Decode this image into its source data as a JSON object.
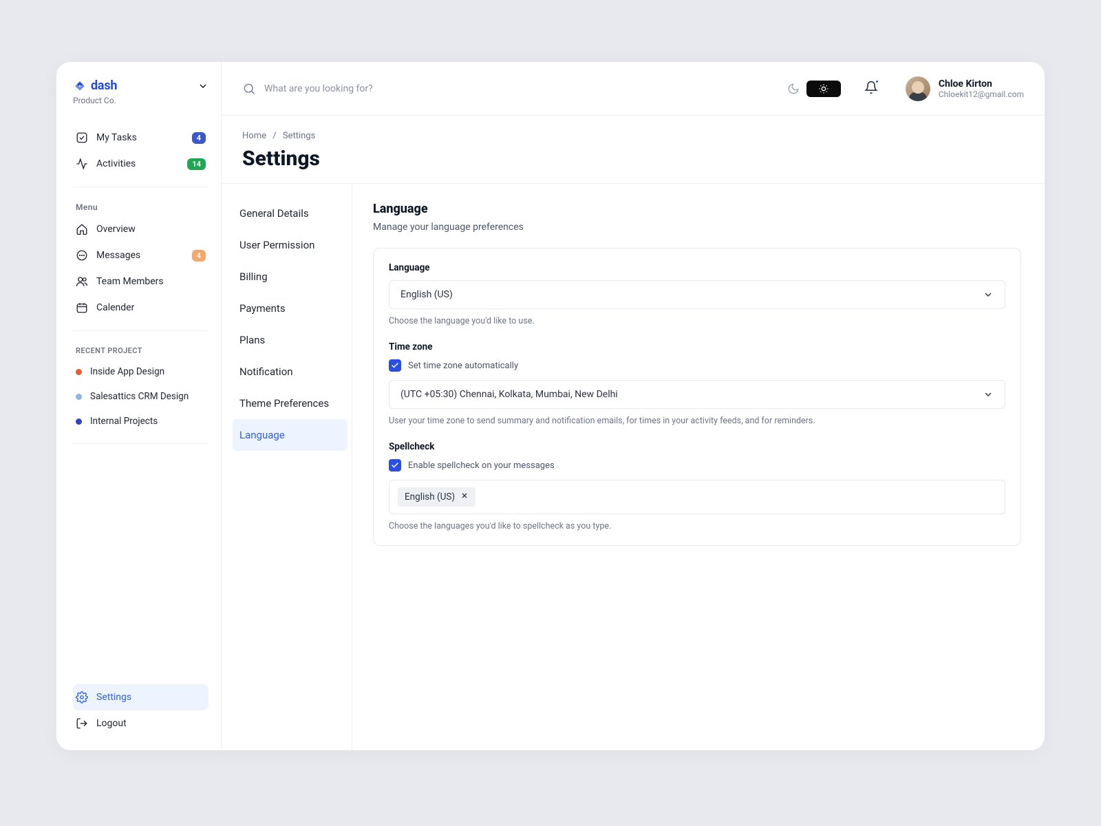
{
  "brand": {
    "name": "dash",
    "subtitle": "Product Co."
  },
  "sidebar": {
    "top": [
      {
        "label": "My Tasks",
        "badge": "4",
        "badgeColor": "#3a58c9"
      },
      {
        "label": "Activities",
        "badge": "14",
        "badgeColor": "#1ea854"
      }
    ],
    "menuLabel": "Menu",
    "menu": [
      {
        "label": "Overview"
      },
      {
        "label": "Messages",
        "badge": "4",
        "badgeColor": "#f5a86b"
      },
      {
        "label": "Team Members"
      },
      {
        "label": "Calender"
      }
    ],
    "projectsLabel": "RECENT PROJECT",
    "projects": [
      {
        "label": "Inside App Design",
        "dotColor": "#eb5d2f"
      },
      {
        "label": "Salesattics CRM Design",
        "dotColor": "#93b3e8"
      },
      {
        "label": "Internal Projects",
        "dotColor": "#2f46c4"
      }
    ],
    "bottom": [
      {
        "label": "Settings",
        "active": true
      },
      {
        "label": "Logout"
      }
    ]
  },
  "search": {
    "placeholder": "What are you looking for?"
  },
  "user": {
    "name": "Chloe Kirton",
    "email": "Chloekit12@gmail.com"
  },
  "breadcrumb": {
    "a": "Home",
    "b": "Settings"
  },
  "pageTitle": "Settings",
  "settingsNav": [
    "General Details",
    "User Permission",
    "Billing",
    "Payments",
    "Plans",
    "Notification",
    "Theme Preferences",
    "Language"
  ],
  "panel": {
    "title": "Language",
    "subtitle": "Manage your language preferences",
    "language": {
      "label": "Language",
      "value": "English (US)",
      "help": "Choose the language you'd like to use."
    },
    "timezone": {
      "label": "Time zone",
      "checkboxLabel": "Set time zone automatically",
      "value": "(UTC +05:30) Chennai, Kolkata, Mumbai, New Delhi",
      "help": "User your time zone to send summary and notification emails, for times in your activity feeds, and  for reminders."
    },
    "spellcheck": {
      "label": "Spellcheck",
      "checkboxLabel": "Enable spellcheck on your messages",
      "tag": "English (US)",
      "help": "Choose the languages you'd like to spellcheck as you type."
    }
  }
}
